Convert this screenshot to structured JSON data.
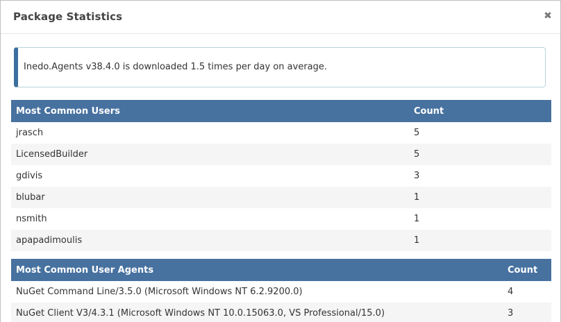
{
  "dialog": {
    "title": "Package Statistics",
    "close_glyph": "✖"
  },
  "info": {
    "message": "Inedo.Agents v38.4.0 is downloaded 1.5 times per day on average."
  },
  "users_table": {
    "headers": [
      "Most Common Users",
      "Count"
    ],
    "rows": [
      {
        "name": "jrasch",
        "count": "5"
      },
      {
        "name": "LicensedBuilder",
        "count": "5"
      },
      {
        "name": "gdivis",
        "count": "3"
      },
      {
        "name": "blubar",
        "count": "1"
      },
      {
        "name": "nsmith",
        "count": "1"
      },
      {
        "name": "apapadimoulis",
        "count": "1"
      }
    ]
  },
  "agents_table": {
    "headers": [
      "Most Common User Agents",
      "Count"
    ],
    "rows": [
      {
        "name": "NuGet Command Line/3.5.0 (Microsoft Windows NT 6.2.9200.0)",
        "count": "4"
      },
      {
        "name": "NuGet Client V3/4.3.1 (Microsoft Windows NT 10.0.15063.0, VS Professional/15.0)",
        "count": "3"
      }
    ]
  },
  "colors": {
    "header_bg": "#47719f",
    "info_accent": "#3b6fa0",
    "info_border": "#b9d3d9",
    "row_alt": "#f5f5f5"
  },
  "icons": {
    "close": "close-icon"
  }
}
